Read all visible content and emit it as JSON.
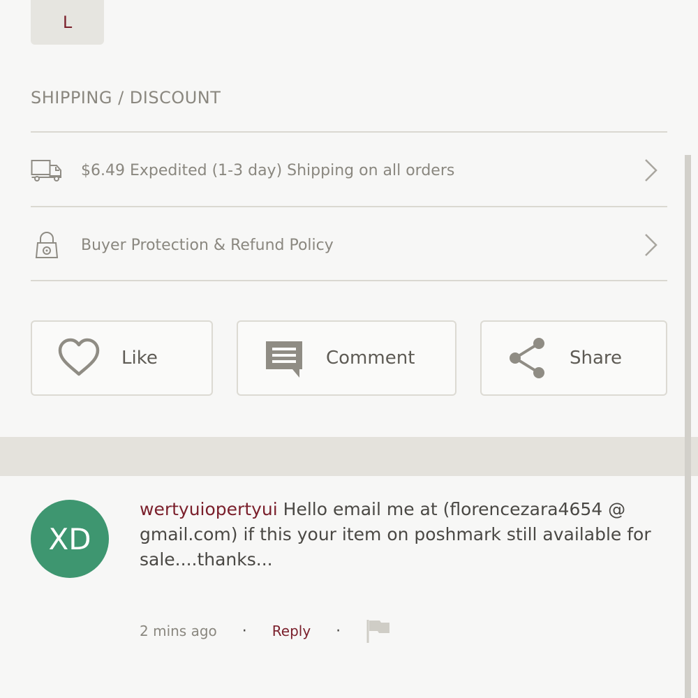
{
  "size": {
    "selected": "L"
  },
  "shipping_section": {
    "title": "SHIPPING / DISCOUNT",
    "rows": [
      {
        "icon": "truck-icon",
        "label": "$6.49 Expedited (1-3 day) Shipping on all orders"
      },
      {
        "icon": "lock-icon",
        "label": "Buyer Protection & Refund Policy"
      }
    ]
  },
  "actions": {
    "like_label": "Like",
    "comment_label": "Comment",
    "share_label": "Share"
  },
  "comment": {
    "avatar_initials": "XD",
    "avatar_color": "#3e9670",
    "username": "wertyuiopertyui",
    "text": " Hello email me at (florencezara4654 @ gmail.com) if this your item on poshmark still available for sale....thanks...",
    "timestamp": "2 mins ago",
    "reply_label": "Reply",
    "separator": "·"
  },
  "colors": {
    "accent": "#7a1f2b",
    "background": "#f7f7f6",
    "icon_gray": "#8f8c84"
  }
}
